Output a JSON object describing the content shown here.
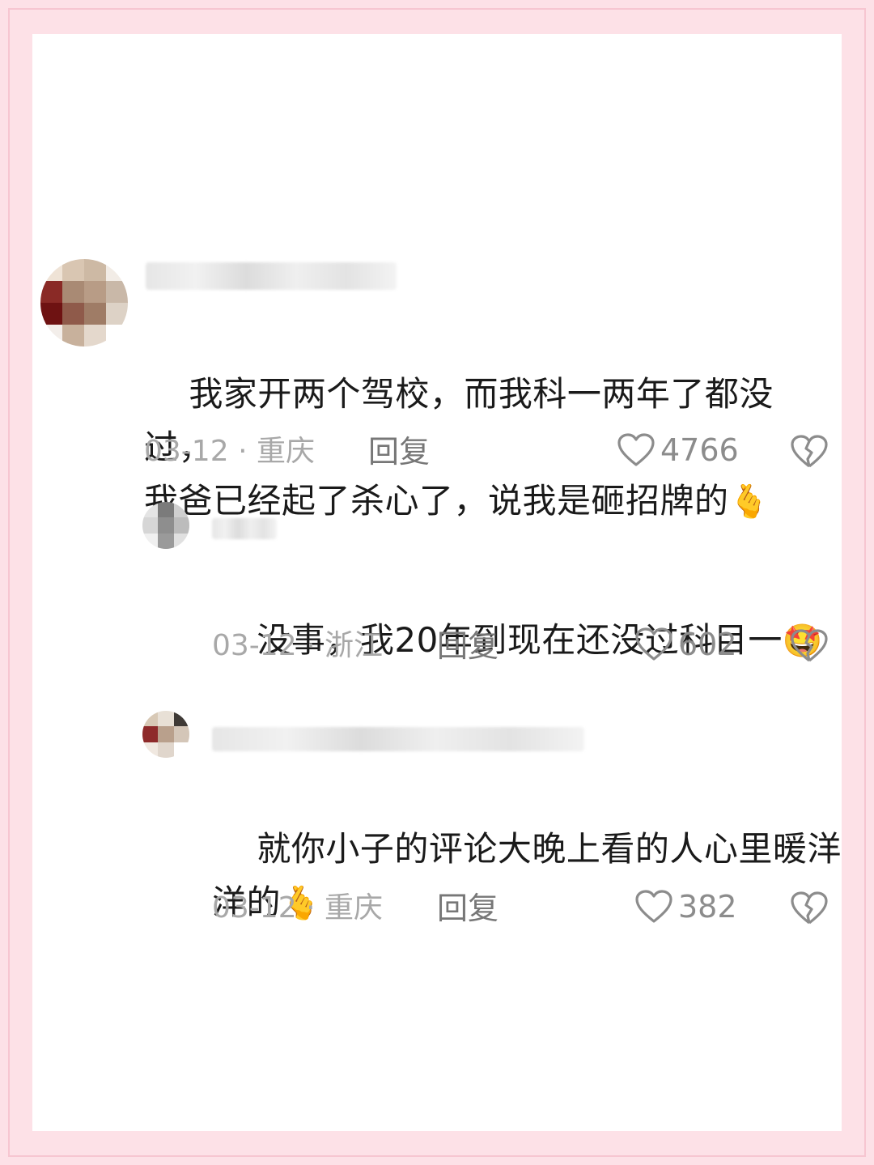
{
  "comments": [
    {
      "text": "我家开两个驾校，而我科一两年了都没过，\n我爸已经起了杀心了，说我是砸招牌的",
      "emoji": "🫰",
      "date": "03-12",
      "location": "重庆",
      "reply_label": "回复",
      "likes": "4766"
    },
    {
      "text": "没事，我20年到现在还没过科目一",
      "emoji": "🤩",
      "date": "03-12",
      "location": "浙江",
      "reply_label": "回复",
      "likes": "602"
    },
    {
      "text": "就你小子的评论大晚上看的人心里暖洋\n洋的",
      "emoji": "🫰",
      "date": "03-12",
      "location": "重庆",
      "reply_label": "回复",
      "likes": "382"
    }
  ],
  "meta_separator": "·",
  "colors": {
    "background": "#fde1e7",
    "frame": "#f7c6d1",
    "text": "#1a1a1a",
    "meta": "#a8a8a8"
  },
  "icons": {
    "like": "heart-outline-icon",
    "dislike": "broken-heart-icon"
  }
}
